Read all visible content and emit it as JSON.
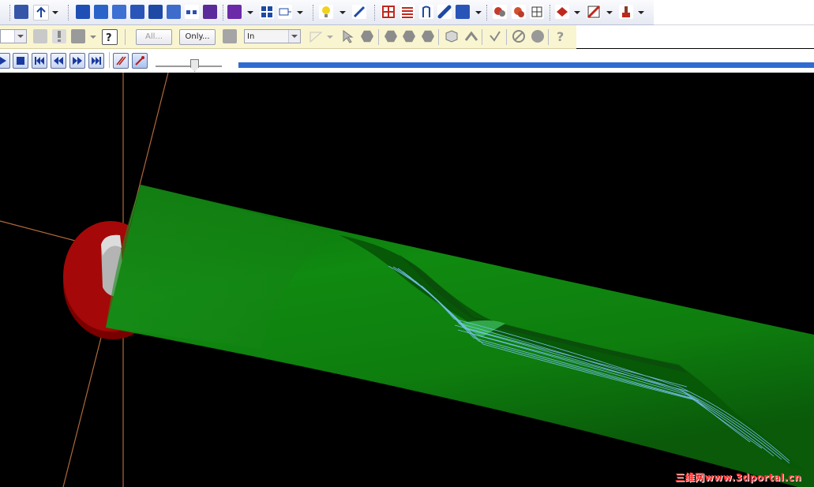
{
  "toolbar2": {
    "all_label": "All...",
    "only_label": "Only...",
    "units_value": "In"
  },
  "watermark": "三维网www.3dportal.cn",
  "playback": {
    "buttons": [
      "play",
      "stop",
      "go-to-start",
      "step-back",
      "step-forward",
      "go-to-end"
    ]
  },
  "colors": {
    "stock": "#0c7f0c",
    "fixture": "#a00000",
    "toolpath": "#7fc7ff",
    "timeline": "#2f6bd1"
  }
}
